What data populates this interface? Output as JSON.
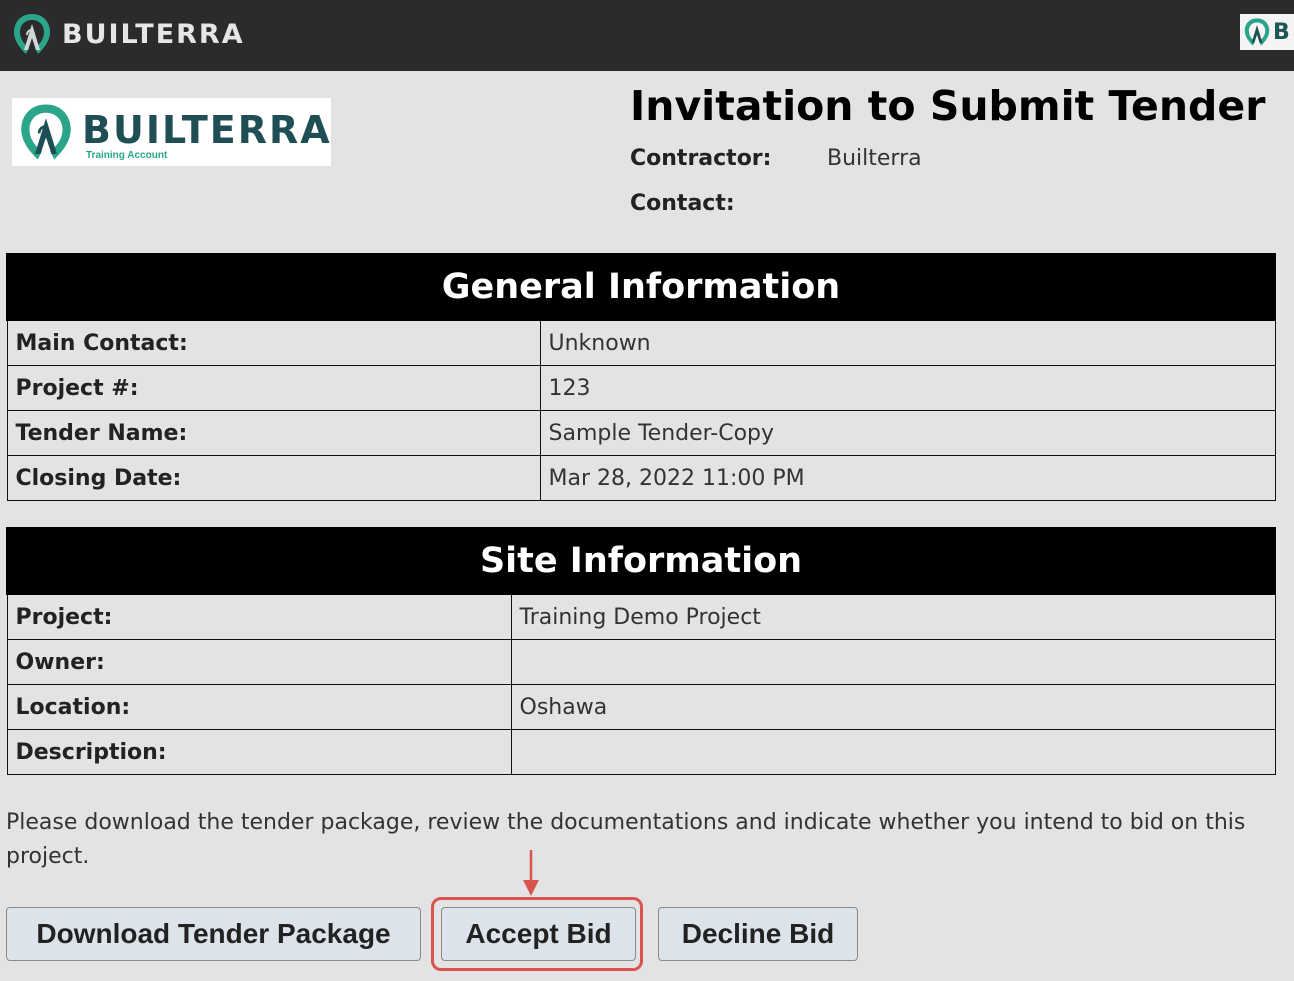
{
  "topbar": {
    "brand": "BUILTERRA",
    "right_logo_letter": "B"
  },
  "header": {
    "logo_name": "BUILTERRA",
    "logo_subtitle": "Training Account",
    "title": "Invitation to Submit Tender",
    "contractor_label": "Contractor:",
    "contractor_value": "Builterra",
    "contact_label": "Contact:",
    "contact_value": ""
  },
  "general": {
    "heading": "General Information",
    "rows": [
      {
        "label": "Main Contact:",
        "value": "Unknown"
      },
      {
        "label": "Project #:",
        "value": "123"
      },
      {
        "label": "Tender Name:",
        "value": "Sample Tender-Copy"
      },
      {
        "label": "Closing Date:",
        "value": "Mar 28, 2022 11:00 PM"
      }
    ]
  },
  "site": {
    "heading": "Site Information",
    "rows": [
      {
        "label": "Project:",
        "value": "Training Demo Project"
      },
      {
        "label": "Owner:",
        "value": ""
      },
      {
        "label": "Location:",
        "value": "Oshawa"
      },
      {
        "label": "Description:",
        "value": ""
      }
    ]
  },
  "instructions": "Please download the tender package, review the documentations and indicate whether you intend to bid on this project.",
  "actions": {
    "download_label": "Download Tender Package",
    "accept_label": "Accept Bid",
    "decline_label": "Decline Bid"
  },
  "colors": {
    "topbar": "#2b2b2b",
    "background": "#e3e3e3",
    "brand_teal": "#1f4f55",
    "brand_green": "#2aa58a",
    "highlight": "#d9534f",
    "button_bg": "#dde3ea"
  },
  "icons": {
    "brand_mark": "builterra-logo-icon",
    "annotation": "arrow-down-icon"
  }
}
